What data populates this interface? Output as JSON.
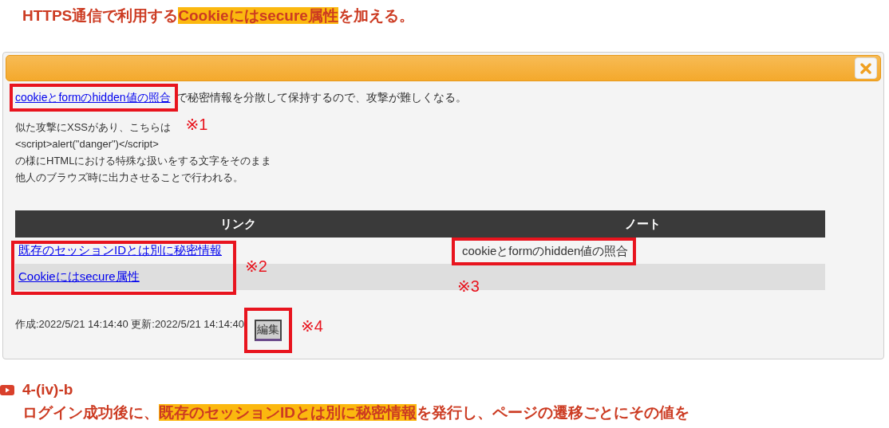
{
  "heading": {
    "parts": [
      {
        "text": "HTTPS通信で利用する",
        "highlighted": false
      },
      {
        "text": "Cookieにはsecure属性",
        "highlighted": true
      },
      {
        "text": "を加える。",
        "highlighted": false
      }
    ]
  },
  "dialog": {
    "intro": {
      "link": "cookieとformのhidden値の照合",
      "text": "で秘密情報を分散して保持するので、攻撃が難しくなる。"
    },
    "body_lines": [
      "似た攻撃にXSSがあり、こちらは",
      "<script>alert(\"danger\")</script>",
      "の様にHTMLにおける特殊な扱いをする文字をそのまま",
      "他人のブラウズ時に出力させることで行われる。"
    ],
    "table": {
      "columns": [
        "リンク",
        "ノート"
      ],
      "rows": [
        {
          "link": "既存のセッションIDとは別に秘密情報",
          "note": "cookieとformのhidden値の照合"
        },
        {
          "link": "Cookieにはsecure属性",
          "note": ""
        }
      ]
    },
    "footer": "作成:2022/5/21 14:14:40 更新:2022/5/21 14:14:40",
    "edit_button": "編集"
  },
  "annotations": [
    "※1",
    "※2",
    "※3",
    "※4"
  ],
  "next_section": {
    "title": "4-(iv)-b",
    "parts": [
      {
        "text": "ログイン成功後に、",
        "highlighted": false
      },
      {
        "text": "既存のセッションIDとは別に秘密情報",
        "highlighted": true
      },
      {
        "text": "を発行し、ページの遷移ごとにその値を",
        "highlighted": false
      }
    ]
  }
}
